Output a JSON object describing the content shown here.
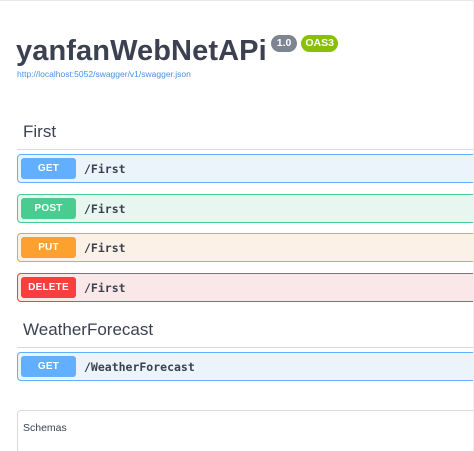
{
  "info": {
    "title": "yanfanWebNetAPi",
    "version": "1.0",
    "oas_badge": "OAS3",
    "spec_url": "http://localhost:5052/swagger/v1/swagger.json"
  },
  "sections": [
    {
      "name": "First",
      "operations": [
        {
          "method": "GET",
          "path": "/First"
        },
        {
          "method": "POST",
          "path": "/First"
        },
        {
          "method": "PUT",
          "path": "/First"
        },
        {
          "method": "DELETE",
          "path": "/First"
        }
      ]
    },
    {
      "name": "WeatherForecast",
      "operations": [
        {
          "method": "GET",
          "path": "/WeatherForecast"
        }
      ]
    }
  ],
  "schemas": {
    "label": "Schemas"
  },
  "colors": {
    "get": "#61affe",
    "post": "#49cc90",
    "put": "#fca130",
    "delete": "#f93e3e",
    "oas_badge": "#89bf04",
    "version_badge": "#7d8492",
    "link": "#4990e2"
  }
}
